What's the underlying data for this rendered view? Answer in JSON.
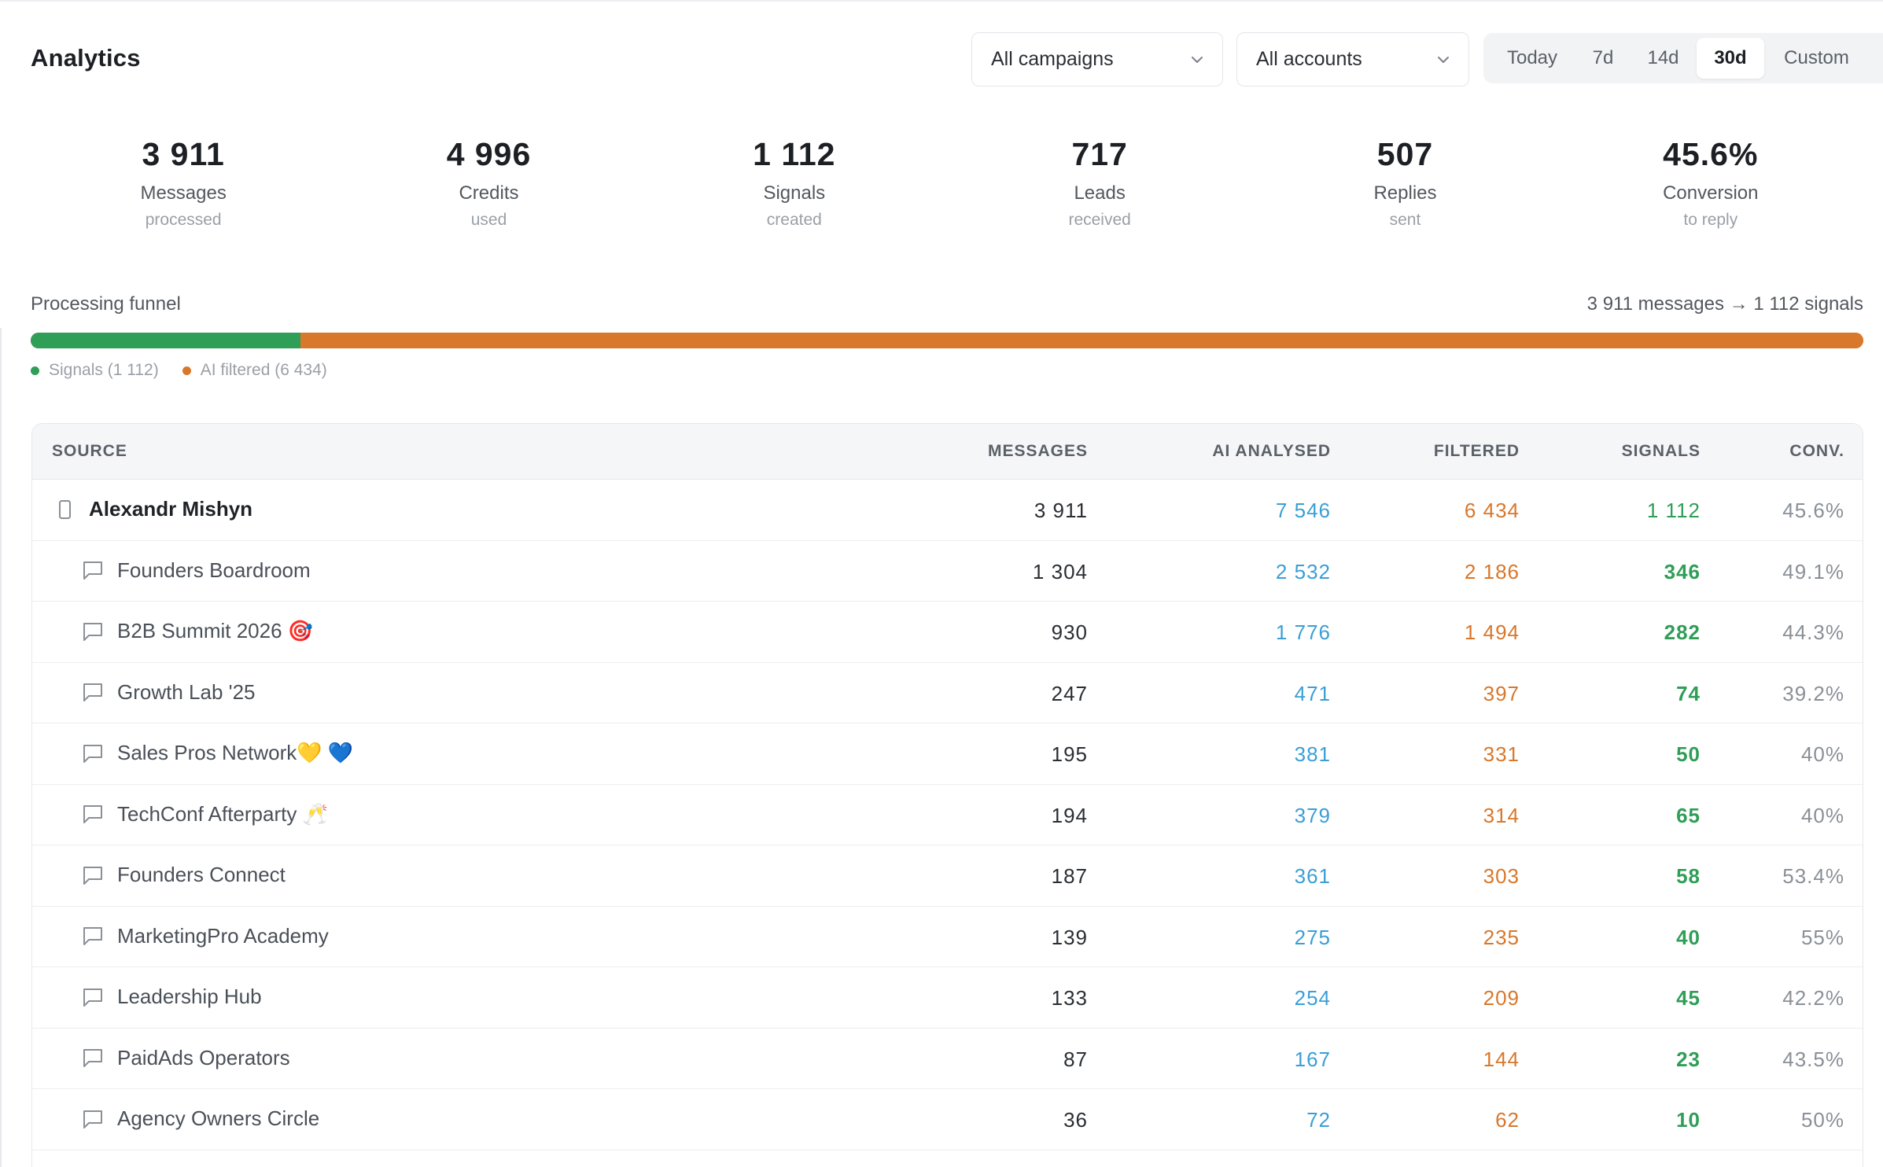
{
  "header": {
    "title": "Analytics",
    "campaign_select": "All campaigns",
    "account_select": "All accounts",
    "ranges": [
      "Today",
      "7d",
      "14d",
      "30d",
      "Custom"
    ],
    "active_range": "30d"
  },
  "stats": [
    {
      "value": "3 911",
      "label": "Messages",
      "sub": "processed"
    },
    {
      "value": "4 996",
      "label": "Credits",
      "sub": "used"
    },
    {
      "value": "1 112",
      "label": "Signals",
      "sub": "created"
    },
    {
      "value": "717",
      "label": "Leads",
      "sub": "received"
    },
    {
      "value": "507",
      "label": "Replies",
      "sub": "sent"
    },
    {
      "value": "45.6%",
      "label": "Conversion",
      "sub": "to reply"
    }
  ],
  "funnel": {
    "title": "Processing funnel",
    "summary": "3 911 messages → 1 112 signals",
    "signals_fraction": 0.147,
    "legend": [
      {
        "label": "Signals (1 112)",
        "color": "#2f9e57"
      },
      {
        "label": "AI filtered (6 434)",
        "color": "#d9772a"
      }
    ]
  },
  "table": {
    "columns": {
      "source": "SOURCE",
      "messages": "MESSAGES",
      "ai_analysed": "AI ANALYSED",
      "filtered": "FILTERED",
      "signals": "SIGNALS",
      "conv": "CONV."
    },
    "rows": [
      {
        "name": "Alexandr Mishyn",
        "icon": "phone-icon",
        "messages": "3 911",
        "ai": "7 546",
        "filtered": "6 434",
        "signals": "1 112",
        "conv": "45.6%"
      },
      {
        "name": "Founders Boardroom",
        "icon": "chat-icon",
        "messages": "1 304",
        "ai": "2 532",
        "filtered": "2 186",
        "signals": "346",
        "conv": "49.1%"
      },
      {
        "name": "B2B Summit 2026 🎯",
        "icon": "chat-icon",
        "messages": "930",
        "ai": "1 776",
        "filtered": "1 494",
        "signals": "282",
        "conv": "44.3%"
      },
      {
        "name": "Growth Lab '25",
        "icon": "chat-icon",
        "messages": "247",
        "ai": "471",
        "filtered": "397",
        "signals": "74",
        "conv": "39.2%"
      },
      {
        "name": "Sales Pros Network💛 💙",
        "icon": "chat-icon",
        "messages": "195",
        "ai": "381",
        "filtered": "331",
        "signals": "50",
        "conv": "40%"
      },
      {
        "name": "TechConf Afterparty 🥂",
        "icon": "chat-icon",
        "messages": "194",
        "ai": "379",
        "filtered": "314",
        "signals": "65",
        "conv": "40%"
      },
      {
        "name": "Founders Connect",
        "icon": "chat-icon",
        "messages": "187",
        "ai": "361",
        "filtered": "303",
        "signals": "58",
        "conv": "53.4%"
      },
      {
        "name": "MarketingPro Academy",
        "icon": "chat-icon",
        "messages": "139",
        "ai": "275",
        "filtered": "235",
        "signals": "40",
        "conv": "55%"
      },
      {
        "name": "Leadership Hub",
        "icon": "chat-icon",
        "messages": "133",
        "ai": "254",
        "filtered": "209",
        "signals": "45",
        "conv": "42.2%"
      },
      {
        "name": "PaidAds Operators",
        "icon": "chat-icon",
        "messages": "87",
        "ai": "167",
        "filtered": "144",
        "signals": "23",
        "conv": "43.5%"
      },
      {
        "name": "Agency Owners Circle",
        "icon": "chat-icon",
        "messages": "36",
        "ai": "72",
        "filtered": "62",
        "signals": "10",
        "conv": "50%"
      }
    ]
  }
}
